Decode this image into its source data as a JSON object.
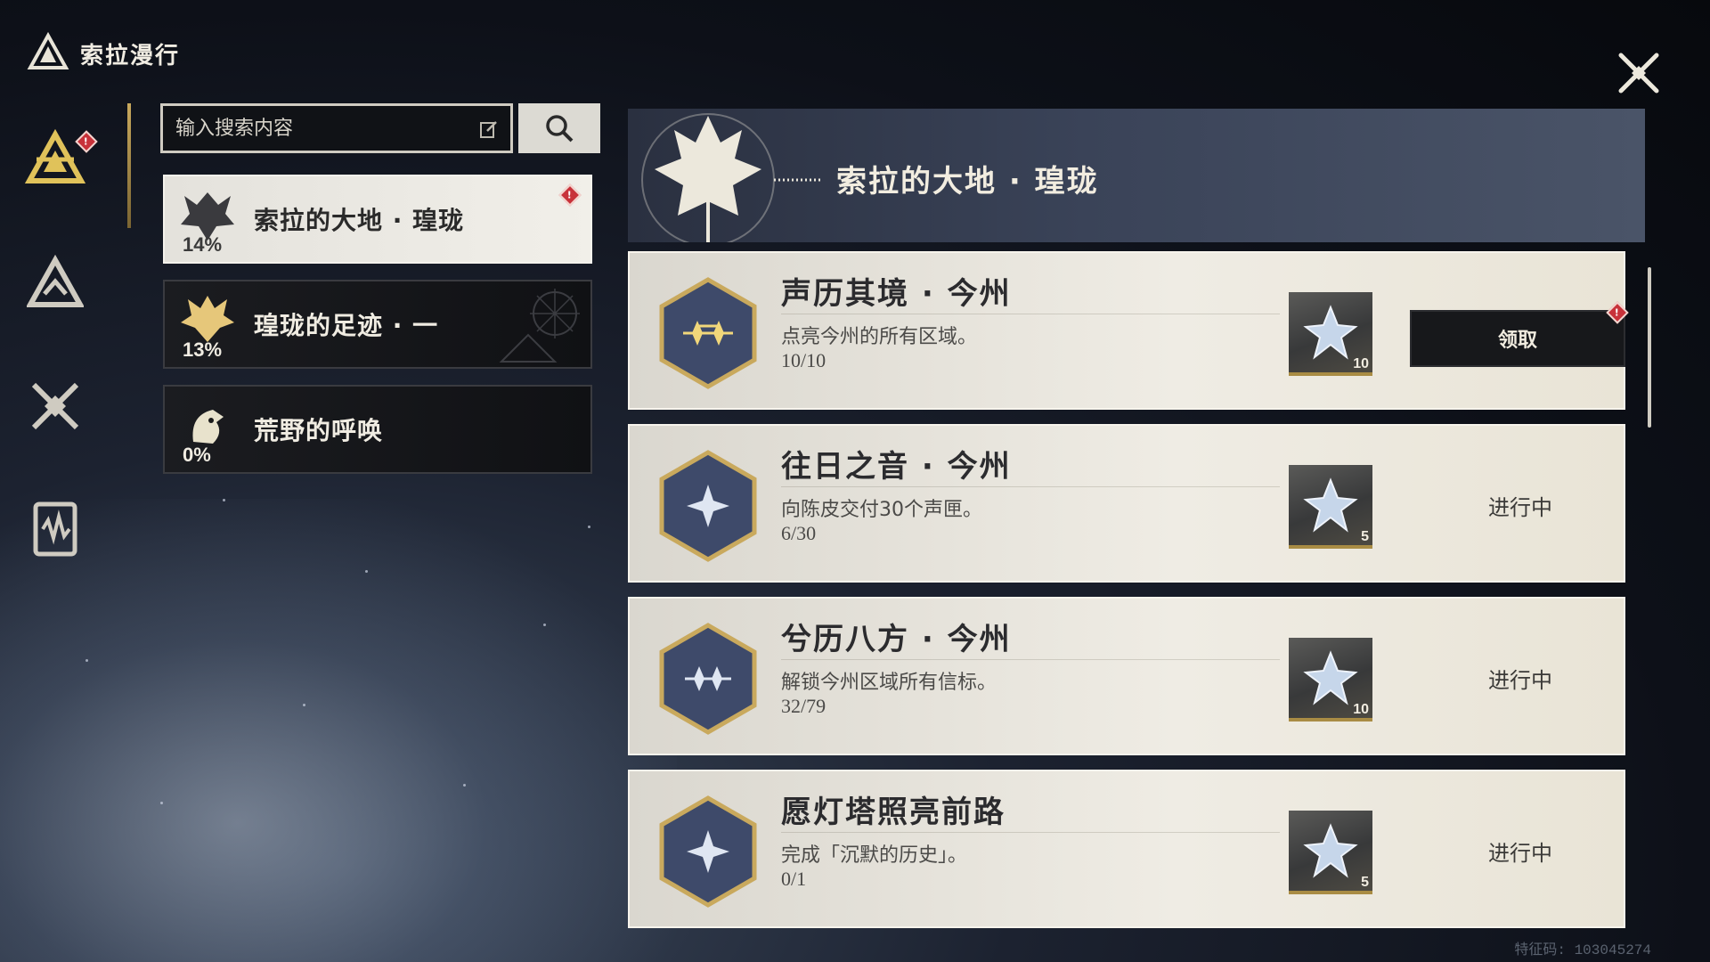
{
  "app": {
    "title": "索拉漫行"
  },
  "colors": {
    "accent_gold": "#c9a95d",
    "alert_red": "#c8323a",
    "card_bg": "#efece4"
  },
  "rail": {
    "items": [
      {
        "icon": "tri-star-emblem-icon",
        "active": true,
        "has_alert": true
      },
      {
        "icon": "mountain-triangle-icon",
        "active": false,
        "has_alert": false
      },
      {
        "icon": "crossed-swords-icon",
        "active": false,
        "has_alert": false
      },
      {
        "icon": "waveform-card-icon",
        "active": false,
        "has_alert": false
      }
    ]
  },
  "search": {
    "placeholder": "输入搜索内容",
    "edit_icon": "edit-icon",
    "button_icon": "search-icon"
  },
  "categories": [
    {
      "label": "索拉的大地 · 瑝珑",
      "percent": "14%",
      "active": true,
      "has_alert": true,
      "icon": "dragon-head-icon"
    },
    {
      "label": "瑝珑的足迹 · 一",
      "percent": "13%",
      "active": false,
      "has_alert": false,
      "icon": "beast-crest-icon"
    },
    {
      "label": "荒野的呼唤",
      "percent": "0%",
      "active": false,
      "has_alert": false,
      "icon": "bird-head-icon"
    }
  ],
  "banner": {
    "title": "索拉的大地 · 瑝珑"
  },
  "achievements": [
    {
      "title": "声历其境 · 今州",
      "desc": "点亮今州的所有区域。",
      "progress": "10/10",
      "reward_count": "10",
      "status": "领取",
      "claimable": true
    },
    {
      "title": "往日之音 · 今州",
      "desc": "向陈皮交付30个声匣。",
      "progress": "6/30",
      "reward_count": "5",
      "status": "进行中",
      "claimable": false
    },
    {
      "title": "兮历八方 · 今州",
      "desc": "解锁今州区域所有信标。",
      "progress": "32/79",
      "reward_count": "10",
      "status": "进行中",
      "claimable": false
    },
    {
      "title": "愿灯塔照亮前路",
      "desc": "完成「沉默的历史」。",
      "progress": "0/1",
      "reward_count": "5",
      "status": "进行中",
      "claimable": false
    }
  ],
  "footer": {
    "watermark": "特征码: 103045274"
  }
}
